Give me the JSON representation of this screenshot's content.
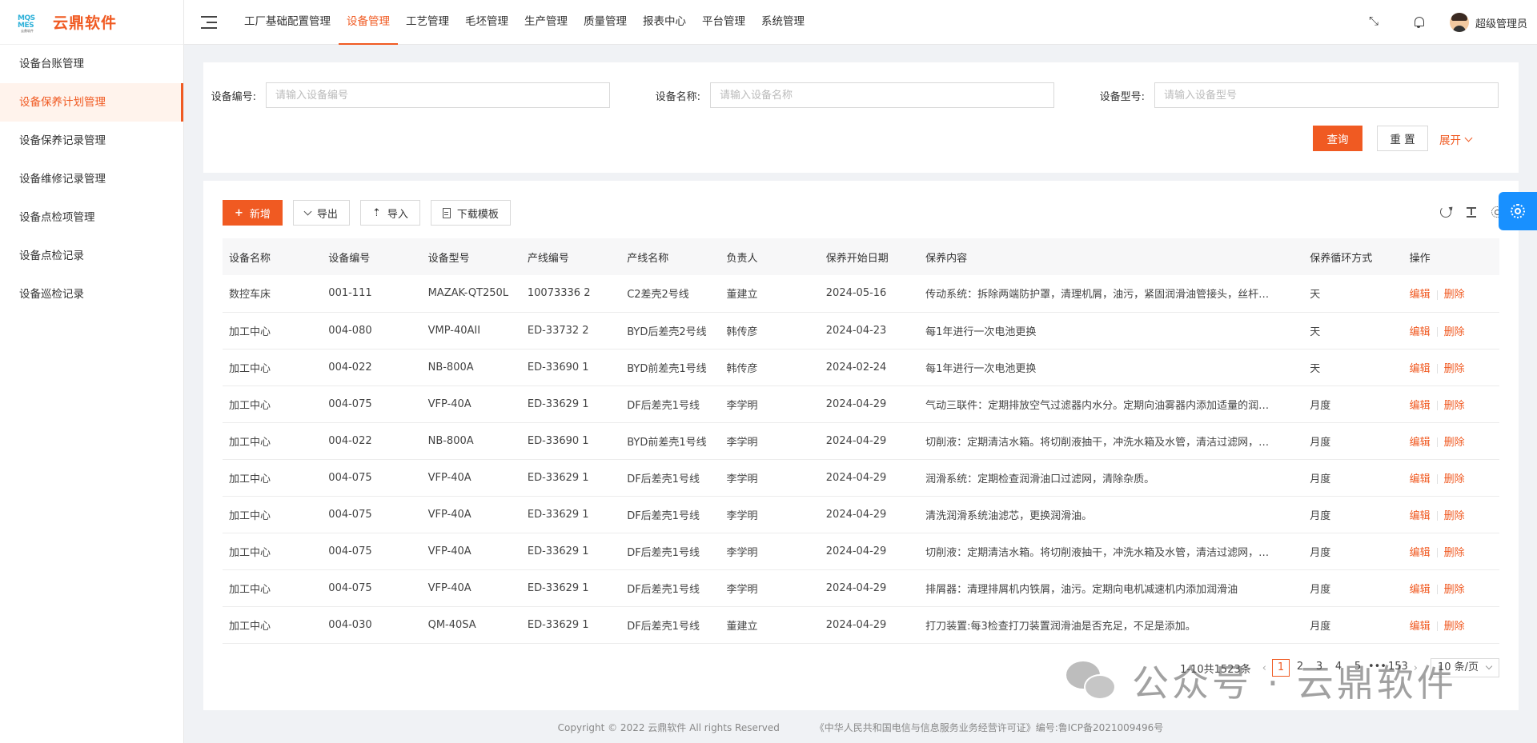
{
  "brand": {
    "logo_mark_line1": "MQS",
    "logo_mark_line2": "MES",
    "logo_mark_line3": "云鼎软件",
    "name": "云鼎软件"
  },
  "sidebar": {
    "items": [
      {
        "label": "设备台账管理",
        "active": false
      },
      {
        "label": "设备保养计划管理",
        "active": true
      },
      {
        "label": "设备保养记录管理",
        "active": false
      },
      {
        "label": "设备维修记录管理",
        "active": false
      },
      {
        "label": "设备点检项管理",
        "active": false
      },
      {
        "label": "设备点检记录",
        "active": false
      },
      {
        "label": "设备巡检记录",
        "active": false
      }
    ]
  },
  "header": {
    "nav": [
      "工厂基础配置管理",
      "设备管理",
      "工艺管理",
      "毛坯管理",
      "生产管理",
      "质量管理",
      "报表中心",
      "平台管理",
      "系统管理"
    ],
    "active_nav": "设备管理",
    "username": "超级管理员"
  },
  "search": {
    "device_code_label": "设备编号:",
    "device_code_placeholder": "请输入设备编号",
    "device_code_value": "",
    "device_name_label": "设备名称:",
    "device_name_placeholder": "请输入设备名称",
    "device_name_value": "",
    "device_model_label": "设备型号:",
    "device_model_placeholder": "请输入设备型号",
    "device_model_value": "",
    "query_label": "查询",
    "reset_label": "重 置",
    "expand_label": "展开"
  },
  "toolbar": {
    "add_label": "新增",
    "export_label": "导出",
    "import_label": "导入",
    "template_label": "下载模板"
  },
  "table": {
    "columns": [
      "设备名称",
      "设备编号",
      "设备型号",
      "产线编号",
      "产线名称",
      "负责人",
      "保养开始日期",
      "保养内容",
      "保养循环方式",
      "操作"
    ],
    "edit_label": "编辑",
    "delete_label": "删除",
    "rows": [
      [
        "数控车床",
        "001-111",
        "MAZAK-QT250L",
        "10073336 2",
        "C2差壳2号线",
        "董建立",
        "2024-05-16",
        "传动系统：拆除两端防护罩，清理机屑，油污，紧固润滑油管接头，丝杆…",
        "天"
      ],
      [
        "加工中心",
        "004-080",
        "VMP-40AII",
        "ED-33732 2",
        "BYD后差壳2号线",
        "韩传彦",
        "2024-04-23",
        "每1年进行一次电池更换",
        "天"
      ],
      [
        "加工中心",
        "004-022",
        "NB-800A",
        "ED-33690 1",
        "BYD前差壳1号线",
        "韩传彦",
        "2024-02-24",
        "每1年进行一次电池更换",
        "天"
      ],
      [
        "加工中心",
        "004-075",
        "VFP-40A",
        "ED-33629 1",
        "DF后差壳1号线",
        "李学明",
        "2024-04-29",
        "气动三联件：定期排放空气过滤器内水分。定期向油雾器内添加适量的润…",
        "月度"
      ],
      [
        "加工中心",
        "004-022",
        "NB-800A",
        "ED-33690 1",
        "BYD前差壳1号线",
        "李学明",
        "2024-04-29",
        "切削液：定期清洁水箱。将切削液抽干，冲洗水箱及水管，清洁过滤网，…",
        "月度"
      ],
      [
        "加工中心",
        "004-075",
        "VFP-40A",
        "ED-33629 1",
        "DF后差壳1号线",
        "李学明",
        "2024-04-29",
        "润滑系统：定期检查润滑油口过滤网，清除杂质。",
        "月度"
      ],
      [
        "加工中心",
        "004-075",
        "VFP-40A",
        "ED-33629 1",
        "DF后差壳1号线",
        "李学明",
        "2024-04-29",
        "清洗润滑系统油滤芯，更换润滑油。",
        "月度"
      ],
      [
        "加工中心",
        "004-075",
        "VFP-40A",
        "ED-33629 1",
        "DF后差壳1号线",
        "李学明",
        "2024-04-29",
        "切削液：定期清洁水箱。将切削液抽干，冲洗水箱及水管，清洁过滤网，…",
        "月度"
      ],
      [
        "加工中心",
        "004-075",
        "VFP-40A",
        "ED-33629 1",
        "DF后差壳1号线",
        "李学明",
        "2024-04-29",
        "排屑器：清理排屑机内铁屑，油污。定期向电机减速机内添加润滑油",
        "月度"
      ],
      [
        "加工中心",
        "004-030",
        "QM-40SA",
        "ED-33629 1",
        "DF后差壳1号线",
        "董建立",
        "2024-04-29",
        "打刀装置:每3检查打刀装置润滑油是否充足，不足是添加。",
        "月度"
      ]
    ]
  },
  "pagination": {
    "total_text": "1-10共1523条",
    "prev": "‹",
    "pages": [
      "1",
      "2",
      "3",
      "4",
      "5",
      "•••",
      "153"
    ],
    "current": "1",
    "next": "›",
    "page_size": "10 条/页"
  },
  "footer": {
    "copyright": "Copyright © 2022 云鼎软件 All rights Reserved",
    "license": "《中华人民共和国电信与信息服务业务经营许可证》编号:鲁ICP备2021009496号"
  },
  "watermark": {
    "text": "公众号 · 云鼎软件"
  },
  "colors": {
    "accent": "#f05a22",
    "float_button": "#1890ff"
  }
}
